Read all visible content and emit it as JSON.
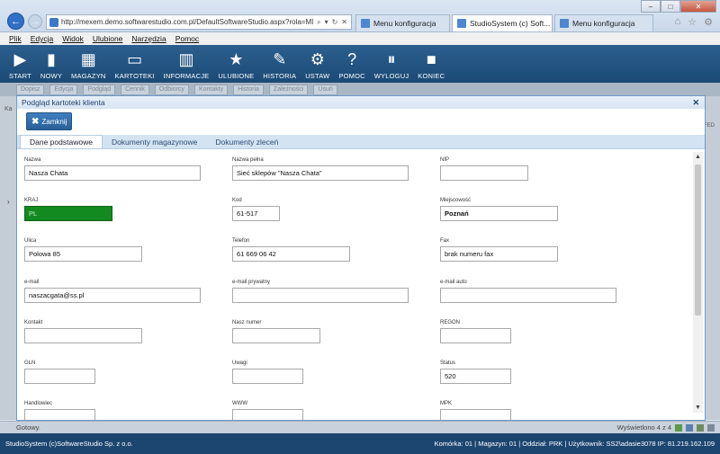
{
  "browser": {
    "url": "http://mexem.demo.softwarestudio.com.pl/DefaultSoftwareStudio.aspx?rola=MI",
    "tabs": [
      {
        "label": "Menu konfiguracja"
      },
      {
        "label": "StudioSystem (c) Soft..."
      },
      {
        "label": "Menu konfiguracja"
      }
    ],
    "win_min": "–",
    "win_max": "□",
    "win_close": "✕"
  },
  "menubar": [
    "Plik",
    "Edycja",
    "Widok",
    "Ulubione",
    "Narzędzia",
    "Pomoc"
  ],
  "toolbar": [
    {
      "label": "START",
      "icon": "▶"
    },
    {
      "label": "NOWY",
      "icon": "▮"
    },
    {
      "label": "MAGAZYN",
      "icon": "▦"
    },
    {
      "label": "KARTOTEKI",
      "icon": "▭"
    },
    {
      "label": "INFORMACJE",
      "icon": "▥"
    },
    {
      "label": "ULUBIONE",
      "icon": "★"
    },
    {
      "label": "HISTORIA",
      "icon": "✎"
    },
    {
      "label": "USTAW",
      "icon": "⚙"
    },
    {
      "label": "POMOC",
      "icon": "?"
    },
    {
      "label": "WYLOGUJ",
      "icon": "⏸"
    },
    {
      "label": "KONIEC",
      "icon": "■"
    }
  ],
  "sub_toolbar": [
    "Dopisz",
    "Edycja",
    "Podgląd",
    "Cennik",
    "Odbiorcy",
    "Kontakty",
    "Historia",
    "Zależności",
    "Usuń"
  ],
  "background": {
    "left_text": "Ka",
    "right_text": "FED",
    "arrow": "›"
  },
  "modal": {
    "title": "Podgląd kartoteki klienta",
    "close": "✕",
    "close_button_label": "Zamknij",
    "tabs": [
      "Dane podstawowe",
      "Dokumenty magazynowe",
      "Dokumenty zleceń"
    ],
    "fields": {
      "nazwa": {
        "label": "Nazwa",
        "value": "Nasza Chata"
      },
      "nazwa_pelna": {
        "label": "Nazwa pełna",
        "value": "Sieć sklepów \"Nasza Chata\""
      },
      "nip": {
        "label": "NIP",
        "value": ""
      },
      "kraj": {
        "label": "KRAJ",
        "value": "PL"
      },
      "kod": {
        "label": "Kod",
        "value": "61-517"
      },
      "miejscowosc": {
        "label": "Miejscowość",
        "value": "Poznań"
      },
      "ulica": {
        "label": "Ulica",
        "value": "Polowa 85"
      },
      "telefon": {
        "label": "Telefon",
        "value": "61 669 06 42"
      },
      "fax": {
        "label": "Fax",
        "value": "brak numeru fax"
      },
      "email": {
        "label": "e-mail",
        "value": "naszacgata@ss.pl"
      },
      "email_prywatny": {
        "label": "e-mail prywatny",
        "value": ""
      },
      "email_auto": {
        "label": "e-mail auto",
        "value": ""
      },
      "kontakt": {
        "label": "Kontakt",
        "value": ""
      },
      "nasz_numer": {
        "label": "Nasz numer",
        "value": ""
      },
      "regon": {
        "label": "REGON",
        "value": ""
      },
      "gln": {
        "label": "GLN",
        "value": ""
      },
      "uwagi": {
        "label": "Uwagi",
        "value": ""
      },
      "status": {
        "label": "Status",
        "value": "520"
      },
      "handlowiec": {
        "label": "Handlowiec",
        "value": ""
      },
      "www": {
        "label": "WWW",
        "value": ""
      },
      "mpk": {
        "label": "MPK",
        "value": ""
      }
    }
  },
  "statusbar": {
    "left": "Gotowy.",
    "right": "Wyświetlono 4 z 4"
  },
  "footer": {
    "left": "StudioSystem (c)SoftwareStudio Sp. z o.o.",
    "right": "Komórka: 01 | Magazyn: 01 | Oddział: PRK | Użytkownik: SS2\\adasie3078 IP: 81.219.162.109"
  },
  "colors": {
    "toolbar": "#1b4a75",
    "accent": "#2a5f97",
    "kraj_fill": "#138a1f"
  }
}
